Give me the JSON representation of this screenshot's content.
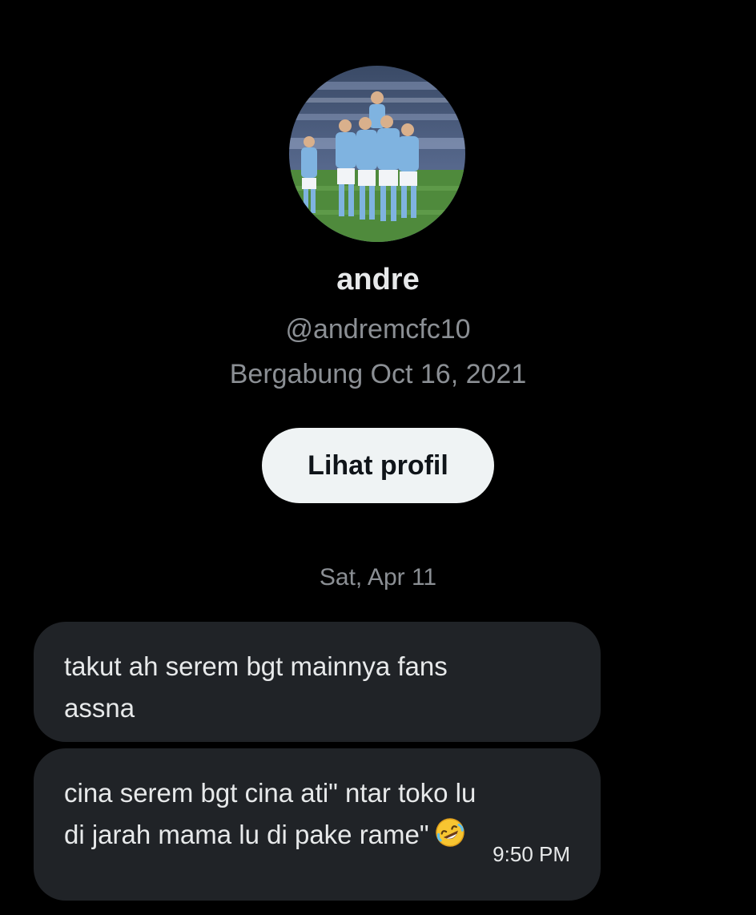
{
  "profile": {
    "display_name": "andre",
    "username": "@andremcfc10",
    "joined": "Bergabung Oct 16, 2021",
    "view_profile_label": "Lihat profil"
  },
  "conversation": {
    "date_separator": "Sat, Apr 11",
    "messages": [
      {
        "text": "takut ah serem bgt mainnya fans\nassna",
        "time": ""
      },
      {
        "text": "cina serem bgt cina ati\" ntar toko lu\ndi jarah mama lu di pake rame\"",
        "emoji": "rolling-on-floor-laughing-emoji",
        "time": "9:50 PM"
      }
    ]
  },
  "colors": {
    "background": "#000000",
    "bubble": "#202327",
    "primary_text": "#e7e9ea",
    "secondary_text": "#8b8f94",
    "button_bg": "#eff3f4",
    "jersey": "#7fb3e0",
    "pitch": "#4f8a3c"
  }
}
